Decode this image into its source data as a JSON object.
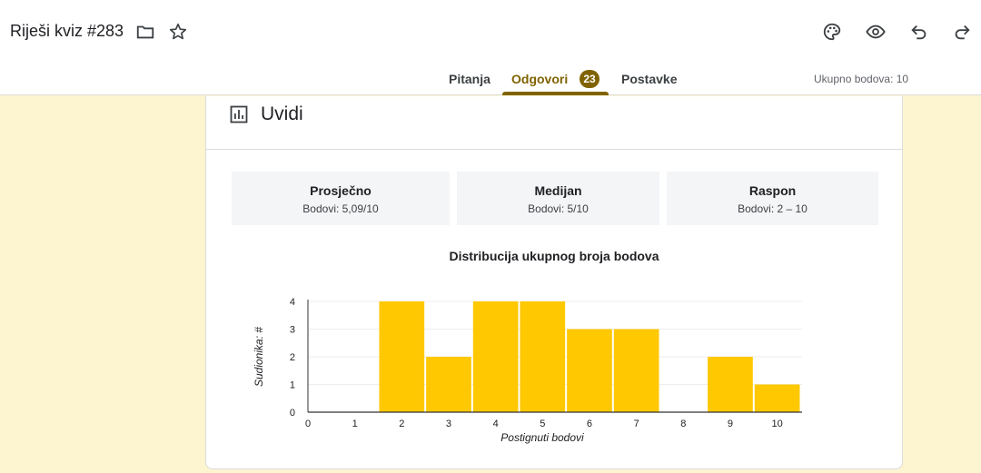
{
  "header": {
    "title": "Riješi kviz #283",
    "tabs": [
      {
        "label": "Pitanja"
      },
      {
        "label": "Odgovori",
        "badge": "23"
      },
      {
        "label": "Postavke"
      }
    ],
    "total_points": "Ukupno bodova: 10",
    "icons": [
      "folder-icon",
      "star-icon",
      "palette-icon",
      "eye-icon",
      "undo-icon",
      "redo-icon"
    ]
  },
  "insights": {
    "title": "Uvidi",
    "stats": [
      {
        "label": "Prosječno",
        "value": "Bodovi: 5,09/10"
      },
      {
        "label": "Medijan",
        "value": "Bodovi: 5/10"
      },
      {
        "label": "Raspon",
        "value": "Bodovi: 2 – 10"
      }
    ]
  },
  "colors": {
    "accent": "#806300",
    "bar": "#ffc800",
    "background": "#fdf4d0"
  },
  "chart_data": {
    "type": "bar",
    "title": "Distribucija ukupnog broja bodova",
    "xlabel": "Postignuti bodovi",
    "ylabel": "Sudionika: #",
    "categories": [
      "0",
      "1",
      "2",
      "3",
      "4",
      "5",
      "6",
      "7",
      "8",
      "9",
      "10"
    ],
    "values": [
      0,
      0,
      4,
      2,
      4,
      4,
      3,
      3,
      0,
      2,
      1
    ],
    "yticks": [
      "0",
      "1",
      "2",
      "3",
      "4"
    ],
    "ylim": [
      0,
      4
    ],
    "grid": true
  }
}
